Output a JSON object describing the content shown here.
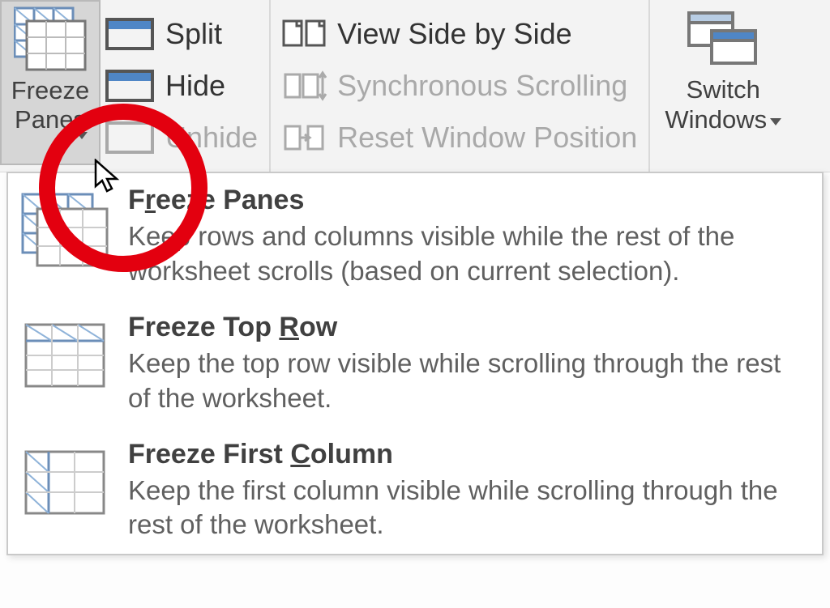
{
  "ribbon": {
    "freeze_panes_button": {
      "line1": "Freeze",
      "line2": "Panes"
    },
    "split": "Split",
    "hide": "Hide",
    "unhide": "Unhide",
    "view_side_by_side": "View Side by Side",
    "synchronous_scrolling": "Synchronous Scrolling",
    "reset_window_position": "Reset Window Position",
    "switch_windows": {
      "line1": "Switch",
      "line2": "Windows"
    }
  },
  "menu": {
    "items": [
      {
        "title_pre": "F",
        "title_u": "r",
        "title_post": "eeze Panes",
        "desc": "Keep rows and columns visible while the rest of the worksheet scrolls (based on current selection)."
      },
      {
        "title_pre": "Freeze Top ",
        "title_u": "R",
        "title_post": "ow",
        "desc": "Keep the top row visible while scrolling through the rest of the worksheet."
      },
      {
        "title_pre": "Freeze First ",
        "title_u": "C",
        "title_post": "olumn",
        "desc": "Keep the first column visible while scrolling through the rest of the worksheet."
      }
    ]
  }
}
